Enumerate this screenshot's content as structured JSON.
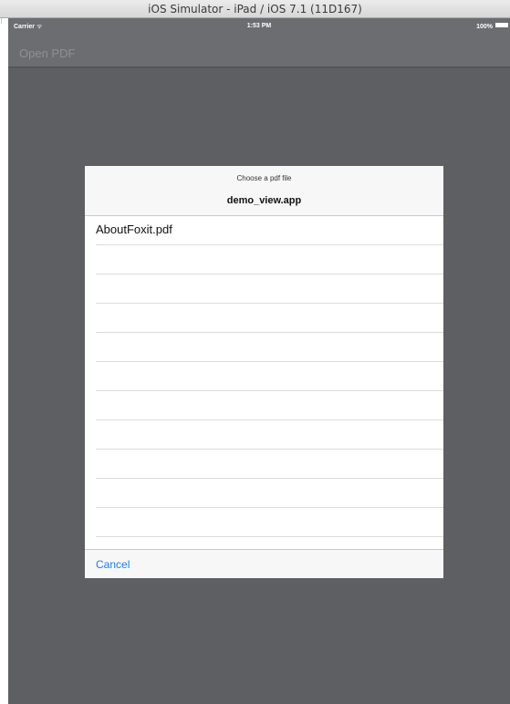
{
  "window": {
    "title": "iOS Simulator - iPad / iOS 7.1 (11D167)"
  },
  "status_bar": {
    "carrier": "Carrier",
    "wifi_icon": "wifi-icon",
    "time": "1:53 PM",
    "battery": "100%",
    "battery_icon": "battery-full-icon"
  },
  "nav": {
    "open_pdf_label": "Open PDF"
  },
  "dialog": {
    "prompt": "Choose a pdf file",
    "title": "demo_view.app",
    "files": [
      "AboutFoxit.pdf",
      "",
      "",
      "",
      "",
      "",
      "",
      "",
      "",
      "",
      "",
      ""
    ],
    "cancel_label": "Cancel"
  }
}
